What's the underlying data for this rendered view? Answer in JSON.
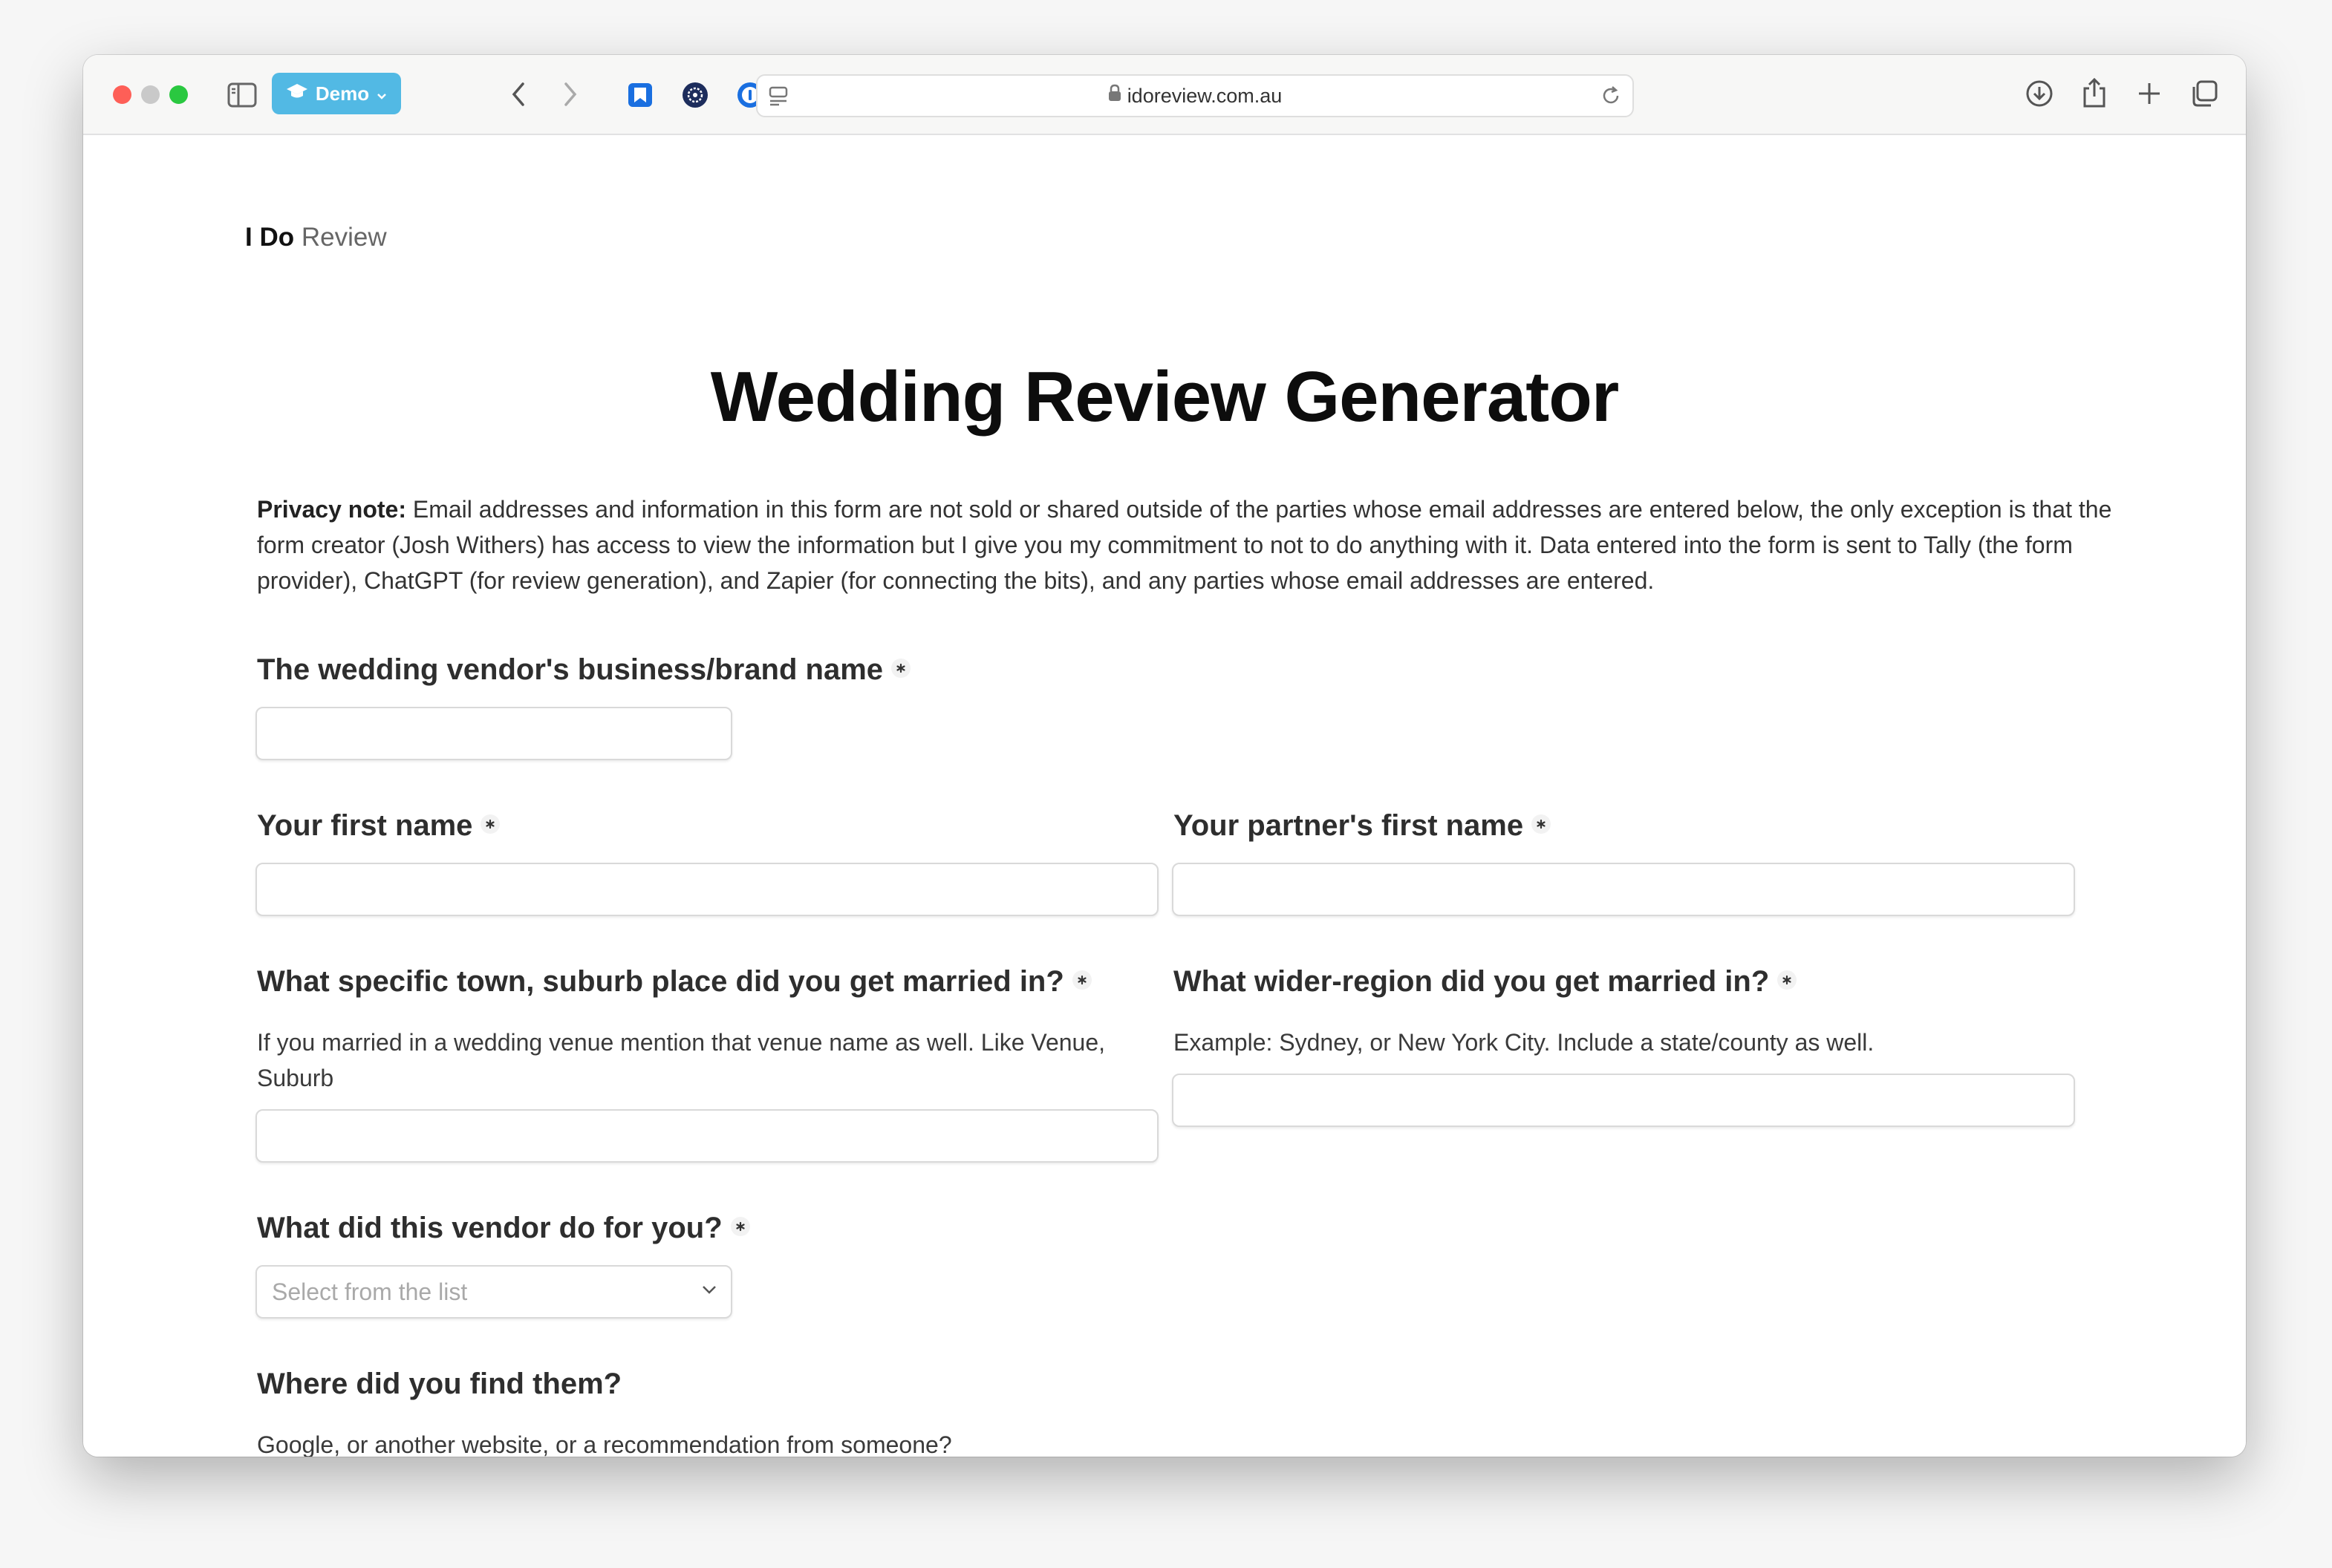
{
  "browser": {
    "profile_label": "Demo",
    "url": "idoreview.com.au"
  },
  "page": {
    "brand_bold": "I Do",
    "brand_light": "Review",
    "title": "Wedding Review Generator",
    "privacy_label": "Privacy note:",
    "privacy_text": "Email addresses and information in this form are not sold or shared outside of the parties whose email addresses are entered below, the only exception is that the form creator (Josh Withers) has access to view the information but I give you my commitment to not to do anything with it. Data entered into the form is sent to Tally (the form provider), ChatGPT (for review generation), and Zapier (for connecting the bits), and any parties whose email addresses are entered."
  },
  "form": {
    "vendor_name": {
      "label": "The wedding vendor's business/brand name",
      "value": ""
    },
    "first_name": {
      "label": "Your first name",
      "value": ""
    },
    "partner_name": {
      "label": "Your partner's first name",
      "value": ""
    },
    "town": {
      "label": "What specific town, suburb place did you get married in?",
      "help": "If you married in a wedding venue mention that venue name as well. Like Venue, Suburb",
      "value": ""
    },
    "region": {
      "label": "What wider-region did you get married in?",
      "help": "Example: Sydney, or New York City. Include a state/county as well.",
      "value": ""
    },
    "service": {
      "label": "What did this vendor do for you?",
      "placeholder": "Select from the list"
    },
    "found": {
      "label": "Where did you find them?",
      "help": "Google, or another website, or a recommendation from someone?",
      "value": ""
    }
  },
  "colors": {
    "profile_bg": "#52b9e4",
    "close": "#fe5f57",
    "minimize": "#c9c9c9",
    "zoom": "#2ac840"
  }
}
